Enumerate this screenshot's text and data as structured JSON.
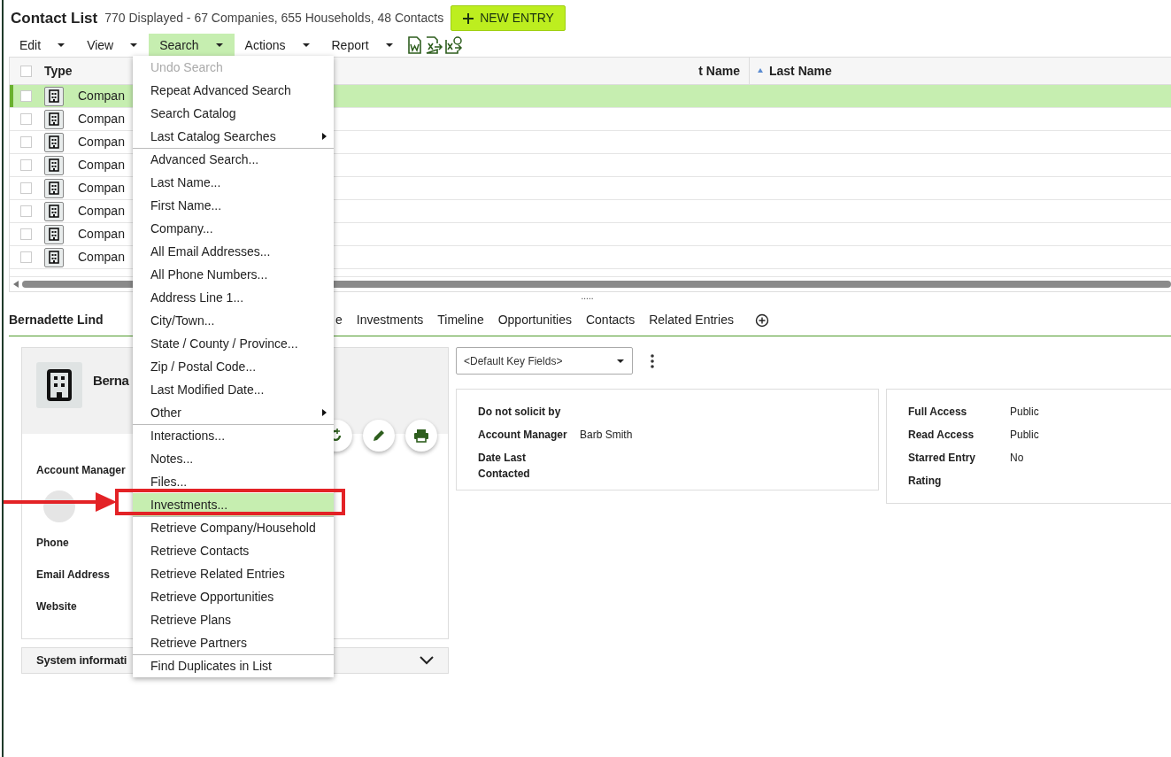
{
  "header": {
    "title": "Contact List",
    "summary": "770 Displayed - 67 Companies, 655 Households, 48 Contacts",
    "new_button": "NEW ENTRY"
  },
  "menubar": [
    {
      "label": "Edit",
      "selected": false
    },
    {
      "label": "View",
      "selected": false
    },
    {
      "label": "Search",
      "selected": true
    },
    {
      "label": "Actions",
      "selected": false
    },
    {
      "label": "Report",
      "selected": false
    }
  ],
  "grid": {
    "select_all_checked": false,
    "columns": [
      {
        "label": "Type",
        "sorted": false
      },
      {
        "label": "t Name",
        "sorted": false
      },
      {
        "label": "Last Name",
        "sorted": true
      }
    ],
    "rows": [
      {
        "type": "Compan",
        "selected": true,
        "checked": false
      },
      {
        "type": "Compan",
        "selected": false,
        "checked": false
      },
      {
        "type": "Compan",
        "selected": false,
        "checked": false
      },
      {
        "type": "Compan",
        "selected": false,
        "checked": false
      },
      {
        "type": "Compan",
        "selected": false,
        "checked": false
      },
      {
        "type": "Compan",
        "selected": false,
        "checked": false
      },
      {
        "type": "Compan",
        "selected": false,
        "checked": false
      },
      {
        "type": "Compan",
        "selected": false,
        "checked": false
      }
    ]
  },
  "splitter": ".....",
  "detail": {
    "title": "Bernadette Lind",
    "tabs": [
      {
        "label": "e",
        "selected": false
      },
      {
        "label": "Investments",
        "selected": false
      },
      {
        "label": "Timeline",
        "selected": false
      },
      {
        "label": "Opportunities",
        "selected": false
      },
      {
        "label": "Contacts",
        "selected": false
      },
      {
        "label": "Related Entries",
        "selected": false
      }
    ],
    "card": {
      "name": "Berna",
      "fields": [
        {
          "label": "Account Manager",
          "kind": "person"
        },
        {
          "label": "Phone"
        },
        {
          "label": "Email Address"
        },
        {
          "label": "Website"
        }
      ]
    },
    "system_info": "System informati",
    "key_fields_select": "<Default Key Fields>",
    "panels": [
      [
        {
          "label": "Do not solicit by"
        },
        {
          "label": "Account Manager",
          "value": "Barb Smith"
        },
        {
          "label": "Date Last Contacted"
        }
      ],
      [
        {
          "label": "Full Access",
          "value": "Public"
        },
        {
          "label": "Read Access",
          "value": "Public"
        },
        {
          "label": "Starred Entry",
          "value": "No"
        },
        {
          "label": "Rating"
        }
      ]
    ]
  },
  "search_menu": [
    {
      "label": "Undo Search",
      "kind": "item",
      "disabled": true,
      "selected": false,
      "divider_before": false
    },
    {
      "label": "Repeat Advanced Search",
      "kind": "item",
      "disabled": false,
      "selected": false,
      "divider_before": false
    },
    {
      "label": "Search Catalog",
      "kind": "item",
      "disabled": false,
      "selected": false,
      "divider_before": false
    },
    {
      "label": "Last Catalog Searches",
      "kind": "submenu",
      "disabled": false,
      "selected": false,
      "divider_before": false
    },
    {
      "label": "Advanced Search...",
      "kind": "item",
      "disabled": false,
      "selected": false,
      "divider_before": true
    },
    {
      "label": "Last Name...",
      "kind": "item",
      "disabled": false,
      "selected": false,
      "divider_before": false
    },
    {
      "label": "First Name...",
      "kind": "item",
      "disabled": false,
      "selected": false,
      "divider_before": false
    },
    {
      "label": "Company...",
      "kind": "item",
      "disabled": false,
      "selected": false,
      "divider_before": false
    },
    {
      "label": "All Email Addresses...",
      "kind": "item",
      "disabled": false,
      "selected": false,
      "divider_before": false
    },
    {
      "label": "All Phone Numbers...",
      "kind": "item",
      "disabled": false,
      "selected": false,
      "divider_before": false
    },
    {
      "label": "Address Line 1...",
      "kind": "item",
      "disabled": false,
      "selected": false,
      "divider_before": false
    },
    {
      "label": "City/Town...",
      "kind": "item",
      "disabled": false,
      "selected": false,
      "divider_before": false
    },
    {
      "label": "State / County / Province...",
      "kind": "item",
      "disabled": false,
      "selected": false,
      "divider_before": false
    },
    {
      "label": "Zip / Postal Code...",
      "kind": "item",
      "disabled": false,
      "selected": false,
      "divider_before": false
    },
    {
      "label": "Last Modified Date...",
      "kind": "item",
      "disabled": false,
      "selected": false,
      "divider_before": false
    },
    {
      "label": "Other",
      "kind": "submenu",
      "disabled": false,
      "selected": false,
      "divider_before": false
    },
    {
      "label": "Interactions...",
      "kind": "item",
      "disabled": false,
      "selected": false,
      "divider_before": true
    },
    {
      "label": "Notes...",
      "kind": "item",
      "disabled": false,
      "selected": false,
      "divider_before": false
    },
    {
      "label": "Files...",
      "kind": "item",
      "disabled": false,
      "selected": false,
      "divider_before": false
    },
    {
      "label": "Investments...",
      "kind": "item",
      "disabled": false,
      "selected": true,
      "divider_before": false
    },
    {
      "label": "Retrieve Company/Household",
      "kind": "item",
      "disabled": false,
      "selected": false,
      "divider_before": true
    },
    {
      "label": "Retrieve Contacts",
      "kind": "item",
      "disabled": false,
      "selected": false,
      "divider_before": false
    },
    {
      "label": "Retrieve Related Entries",
      "kind": "item",
      "disabled": false,
      "selected": false,
      "divider_before": false
    },
    {
      "label": "Retrieve Opportunities",
      "kind": "item",
      "disabled": false,
      "selected": false,
      "divider_before": false
    },
    {
      "label": "Retrieve Plans",
      "kind": "item",
      "disabled": false,
      "selected": false,
      "divider_before": false
    },
    {
      "label": "Retrieve Partners",
      "kind": "item",
      "disabled": false,
      "selected": false,
      "divider_before": false
    },
    {
      "label": "Find Duplicates in List",
      "kind": "item",
      "disabled": false,
      "selected": false,
      "divider_before": true
    }
  ]
}
